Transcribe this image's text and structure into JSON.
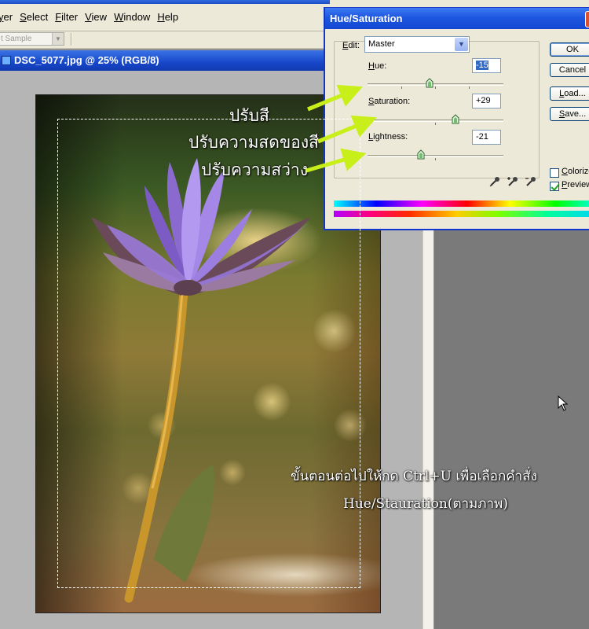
{
  "menu": {
    "items": [
      "yer",
      "Select",
      "Filter",
      "View",
      "Window",
      "Help"
    ]
  },
  "options": {
    "sample_select": "t Sample"
  },
  "document": {
    "title": "DSC_5077.jpg @ 25% (RGB/8)"
  },
  "dialog": {
    "title": "Hue/Saturation",
    "edit_label": "Edit:",
    "edit_value": "Master",
    "hue": {
      "label": "Hue:",
      "value": "-15",
      "range": [
        -180,
        180
      ]
    },
    "saturation": {
      "label": "Saturation:",
      "value": "+29",
      "range": [
        -100,
        100
      ]
    },
    "lightness": {
      "label": "Lightness:",
      "value": "-21",
      "range": [
        -100,
        100
      ]
    },
    "buttons": {
      "ok": "OK",
      "cancel": "Cancel",
      "load": "Load...",
      "save": "Save..."
    },
    "colorize": {
      "label": "Colorize",
      "checked": false
    },
    "preview": {
      "label": "Preview",
      "checked": true
    },
    "icons": [
      "eyedropper-icon",
      "eyedropper-plus-icon",
      "eyedropper-minus-icon"
    ]
  },
  "annotations": {
    "hue": "ปรับสี",
    "saturation": "ปรับความสดของสี",
    "lightness": "ปรับความสว่าง",
    "step_line1": "ขั้นตอนต่อไปให้กด Ctrl+U เพื่อเลือกคำสั่ง",
    "step_line2": "Hue/Stauration(ตามภาพ)"
  },
  "colors": {
    "titlebar_blue": "#1d57e0",
    "dialog_bg": "#ece9d8",
    "arrow_green": "#c8ef1a",
    "annotation_text": "#ffffff"
  }
}
